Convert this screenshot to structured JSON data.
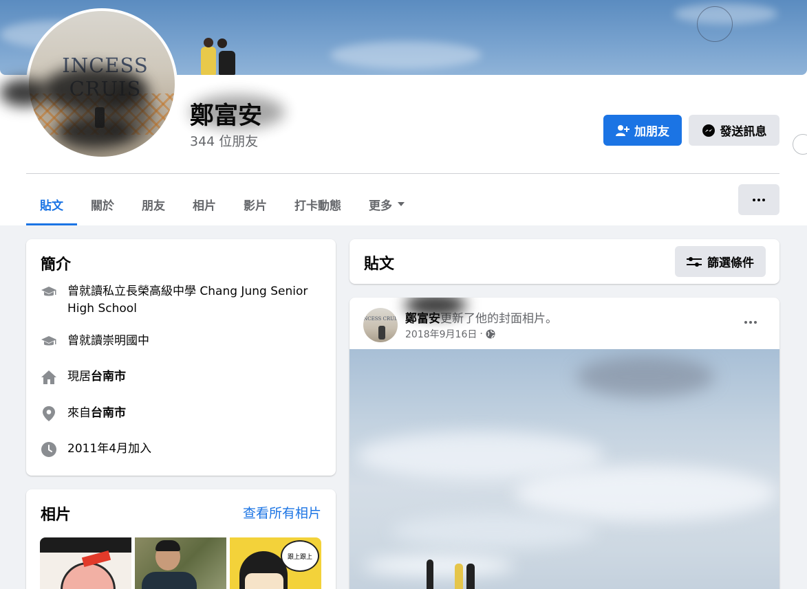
{
  "profile": {
    "name": "鄭富安",
    "friends_count": "344 位朋友",
    "avatar_sign_text": "INCESS CRUIS"
  },
  "actions": {
    "add_friend": "加朋友",
    "send_message": "發送訊息"
  },
  "tabs": [
    {
      "label": "貼文",
      "active": true
    },
    {
      "label": "關於"
    },
    {
      "label": "朋友"
    },
    {
      "label": "相片"
    },
    {
      "label": "影片"
    },
    {
      "label": "打卡動態"
    },
    {
      "label": "更多"
    }
  ],
  "intro": {
    "title": "簡介",
    "items": [
      {
        "icon": "education-cap-icon",
        "prefix": "曾就讀私立長榮高級中學 Chang Jung Senior High School",
        "bold": ""
      },
      {
        "icon": "education-cap-icon",
        "prefix": "曾就讀崇明國中",
        "bold": ""
      },
      {
        "icon": "home-icon",
        "prefix": "現居",
        "bold": "台南市"
      },
      {
        "icon": "location-pin-icon",
        "prefix": "來自",
        "bold": "台南市"
      },
      {
        "icon": "clock-icon",
        "prefix": "2011年4月加入",
        "bold": ""
      }
    ]
  },
  "photos": {
    "title": "相片",
    "see_all": "查看所有相片",
    "bubble_text": "跟上跟上"
  },
  "posts_header": {
    "title": "貼文",
    "filter_label": "篩選條件"
  },
  "post": {
    "author": "鄭富安",
    "action_text": "更新了他的封面相片。",
    "date": "2018年9月16日",
    "separator": "·",
    "avatar_sign_text": "INCESS CRUIS"
  },
  "colors": {
    "accent": "#1b74e4",
    "background": "#f0f2f5",
    "secondary_button": "#e4e6eb",
    "secondary_text": "#65676b"
  }
}
